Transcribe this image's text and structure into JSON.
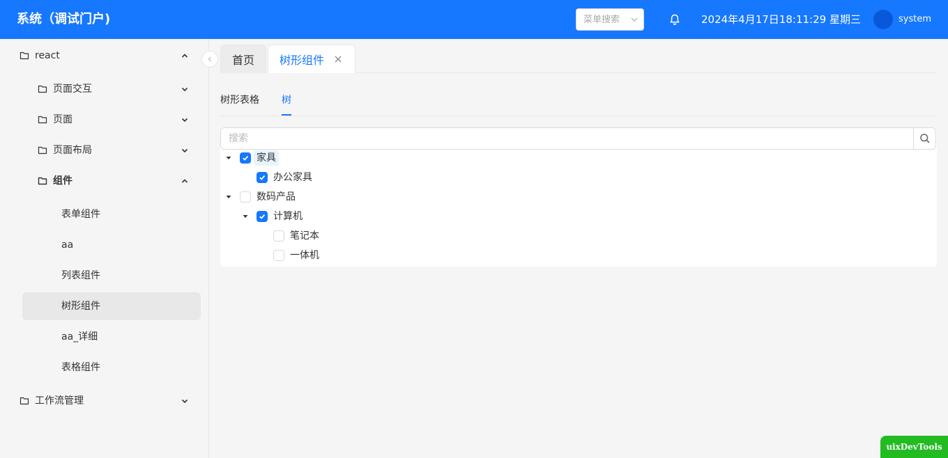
{
  "header": {
    "title": "系统（调试门户)",
    "menu_search_placeholder": "菜单搜索",
    "datetime": "2024年4月17日18:11:29 星期三",
    "username": "system"
  },
  "sidebar": {
    "items": [
      {
        "label": "react",
        "expanded": true
      },
      {
        "label": "页面交互",
        "expanded": false
      },
      {
        "label": "页面",
        "expanded": false
      },
      {
        "label": "页面布局",
        "expanded": false
      },
      {
        "label": "组件",
        "expanded": true
      },
      {
        "label": "表单组件"
      },
      {
        "label": "aa"
      },
      {
        "label": "列表组件"
      },
      {
        "label": "树形组件",
        "active": true
      },
      {
        "label": "aa_详细"
      },
      {
        "label": "表格组件"
      },
      {
        "label": "工作流管理",
        "expanded": false
      }
    ]
  },
  "tabs": {
    "home": "首页",
    "current": "树形组件"
  },
  "sub_tabs": {
    "tab1": "树形表格",
    "tab2": "树"
  },
  "tree": {
    "search_placeholder": "搜索",
    "nodes": [
      {
        "title": "家具",
        "checked": true,
        "expanded": true,
        "selected": true
      },
      {
        "title": "办公家具",
        "checked": true
      },
      {
        "title": "数码产品",
        "checked": false,
        "expanded": true
      },
      {
        "title": "计算机",
        "checked": true,
        "expanded": true
      },
      {
        "title": "笔记本",
        "checked": false
      },
      {
        "title": "一体机",
        "checked": false
      }
    ]
  },
  "devtools": {
    "label": "uixDevTools"
  },
  "colors": {
    "primary": "#1677ff",
    "devtools": "#22bb22"
  }
}
